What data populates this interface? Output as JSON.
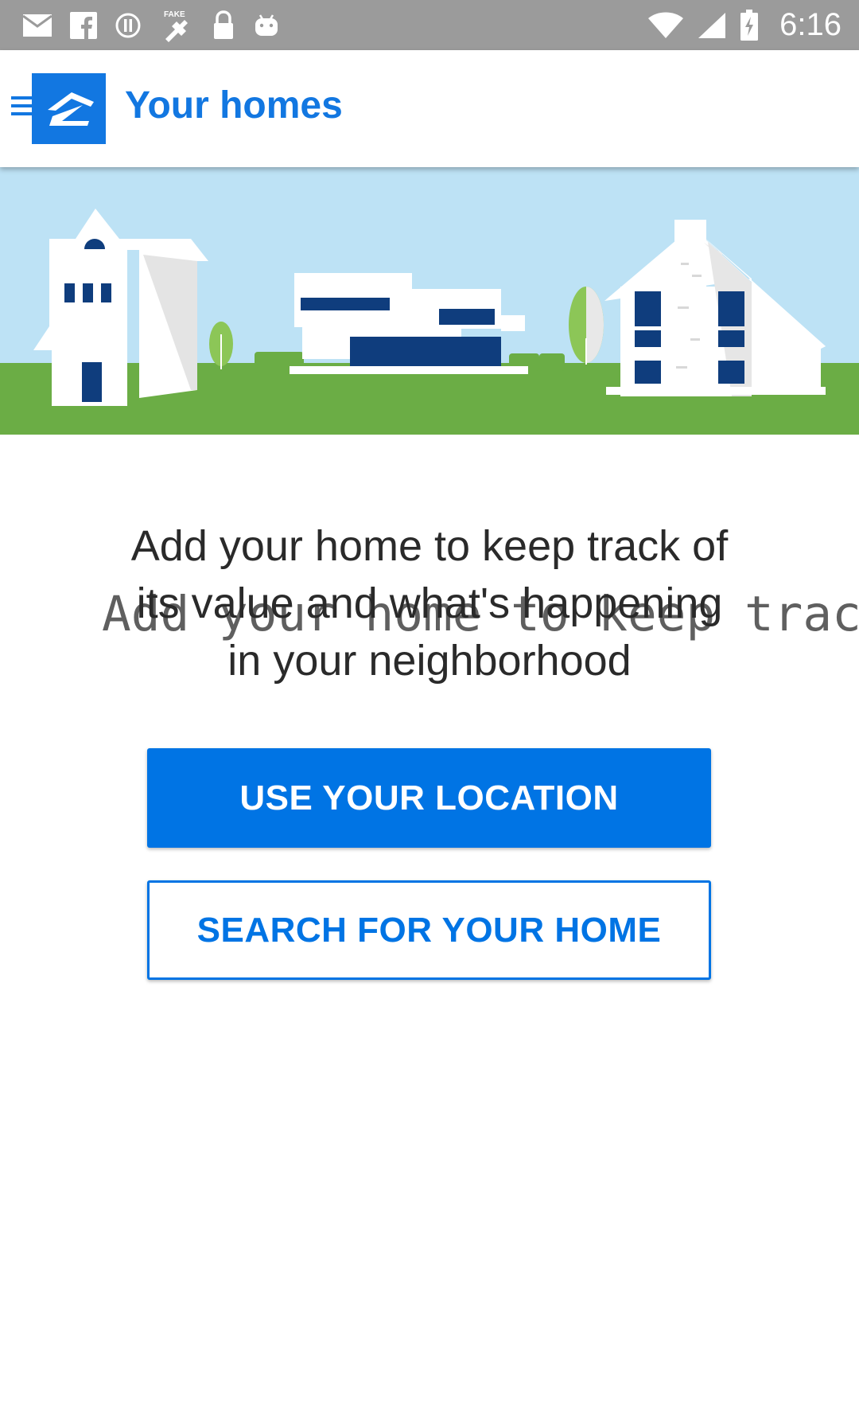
{
  "status_bar": {
    "time": "6:16",
    "left_icons": [
      "mail-icon",
      "facebook-icon",
      "circle-warning-icon",
      "fake-gps-icon",
      "lock-icon",
      "android-icon"
    ],
    "right_icons": [
      "wifi-icon",
      "signal-icon",
      "battery-icon"
    ]
  },
  "app_bar": {
    "title": "Your homes",
    "menu_icon": "hamburger-menu-icon",
    "logo_icon": "zillow-logo-icon",
    "brand_color": "#1277E1"
  },
  "hero": {
    "illustration": "houses-illustration",
    "sky_color": "#BDE2F5",
    "grass_color": "#6BAD45"
  },
  "message": {
    "lines": [
      "Add your home to keep track of",
      "its value and what's happening",
      "in your neighborhood"
    ],
    "overlay_text": "Add your home to keep track of"
  },
  "buttons": {
    "use_location": "USE YOUR LOCATION",
    "search_home": "SEARCH FOR YOUR HOME"
  }
}
